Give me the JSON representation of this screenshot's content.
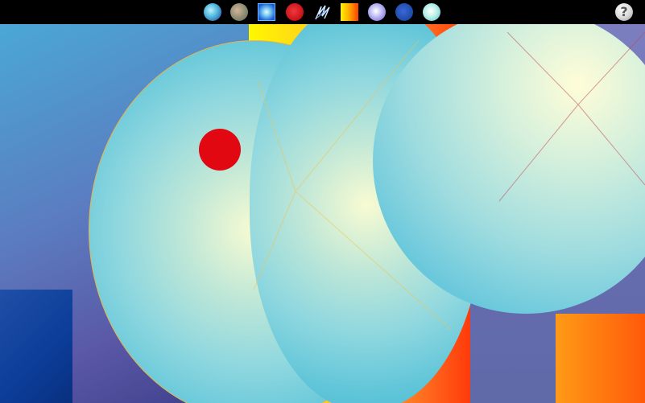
{
  "toolbar": {
    "tools": [
      {
        "name": "blue-sphere-icon"
      },
      {
        "name": "olive-sphere-icon"
      },
      {
        "name": "blue-square-gradient-icon"
      },
      {
        "name": "red-sphere-icon"
      },
      {
        "name": "scribble-icon"
      },
      {
        "name": "yellow-orange-gradient-icon"
      },
      {
        "name": "lavender-sphere-icon"
      },
      {
        "name": "dark-blue-sphere-icon"
      },
      {
        "name": "mint-sphere-icon"
      }
    ],
    "help_label": "?"
  },
  "colors": {
    "background": "#000000",
    "red_dot": "#e10812",
    "cyan_circle": "#5fc5d8",
    "yellow": "#fff700",
    "orange": "#ff3a0a"
  }
}
